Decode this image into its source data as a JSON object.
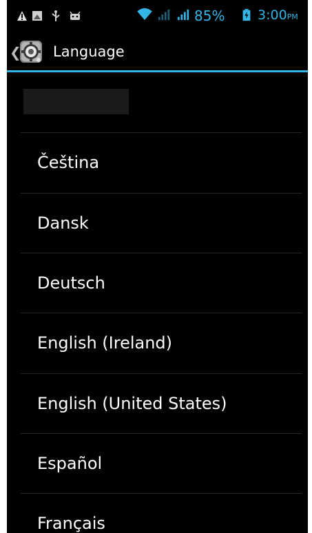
{
  "status_bar": {
    "battery_percent": "85%",
    "time": "3:00",
    "ampm": "PM",
    "icons": [
      "warning-icon",
      "gallery-notification-icon",
      "usb-icon",
      "android-debug-icon",
      "wifi-icon",
      "signal-1-icon",
      "signal-2-icon",
      "battery-icon"
    ],
    "accent_color": "#33b5e5"
  },
  "action_bar": {
    "title": "Language",
    "icon": "settings-icon",
    "accent_color": "#33b5e5"
  },
  "languages": [
    {
      "label": "Čeština"
    },
    {
      "label": "Dansk"
    },
    {
      "label": "Deutsch"
    },
    {
      "label": "English (Ireland)"
    },
    {
      "label": "English (United States)"
    },
    {
      "label": "Español"
    },
    {
      "label": "Français"
    }
  ]
}
